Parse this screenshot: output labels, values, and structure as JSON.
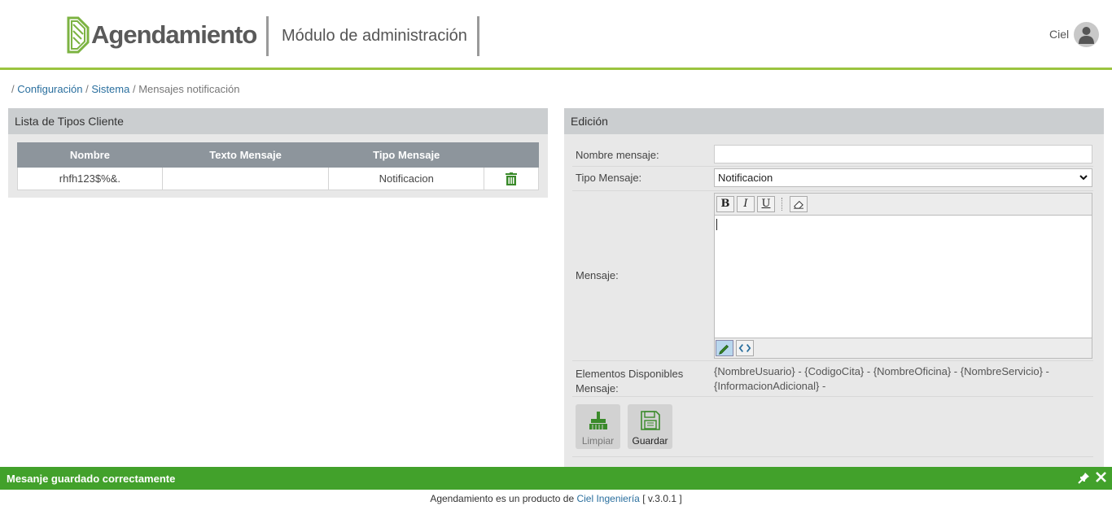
{
  "header": {
    "logo_text": "Agendamiento",
    "module_title": "Módulo de administración",
    "user_name": "Ciel",
    "brand_color": "#9bc43f"
  },
  "breadcrumb": {
    "separator": "/",
    "items": [
      "Configuración",
      "Sistema"
    ],
    "current": "Mensajes notificación"
  },
  "left_panel": {
    "title": "Lista de Tipos Cliente",
    "columns": [
      "Nombre",
      "Texto Mensaje",
      "Tipo Mensaje",
      ""
    ],
    "rows": [
      {
        "nombre": "rhfh123$%&.",
        "texto": "",
        "tipo": "Notificacion",
        "action_icon": "trash-icon"
      }
    ]
  },
  "right_panel": {
    "title": "Edición",
    "nombre_label": "Nombre mensaje:",
    "nombre_value": "",
    "tipo_label": "Tipo Mensaje:",
    "tipo_value": "Notificacion",
    "mensaje_label": "Mensaje:",
    "toolbar": {
      "bold": "B",
      "italic": "I",
      "underline": "U"
    },
    "elementos_label": "Elementos Disponibles Mensaje:",
    "elementos_value": "{NombreUsuario} - {CodigoCita} - {NombreOficina} - {NombreServicio} - {InformacionAdicional} -",
    "btn_limpiar": "Limpiar",
    "btn_guardar": "Guardar"
  },
  "notification": {
    "text": "Mesanje guardado correctamente",
    "color": "#42a12b"
  },
  "footer": {
    "prefix": "Agendamiento es un producto de ",
    "link": "Ciel Ingeniería",
    "version": " [ v.3.0.1 ]"
  }
}
